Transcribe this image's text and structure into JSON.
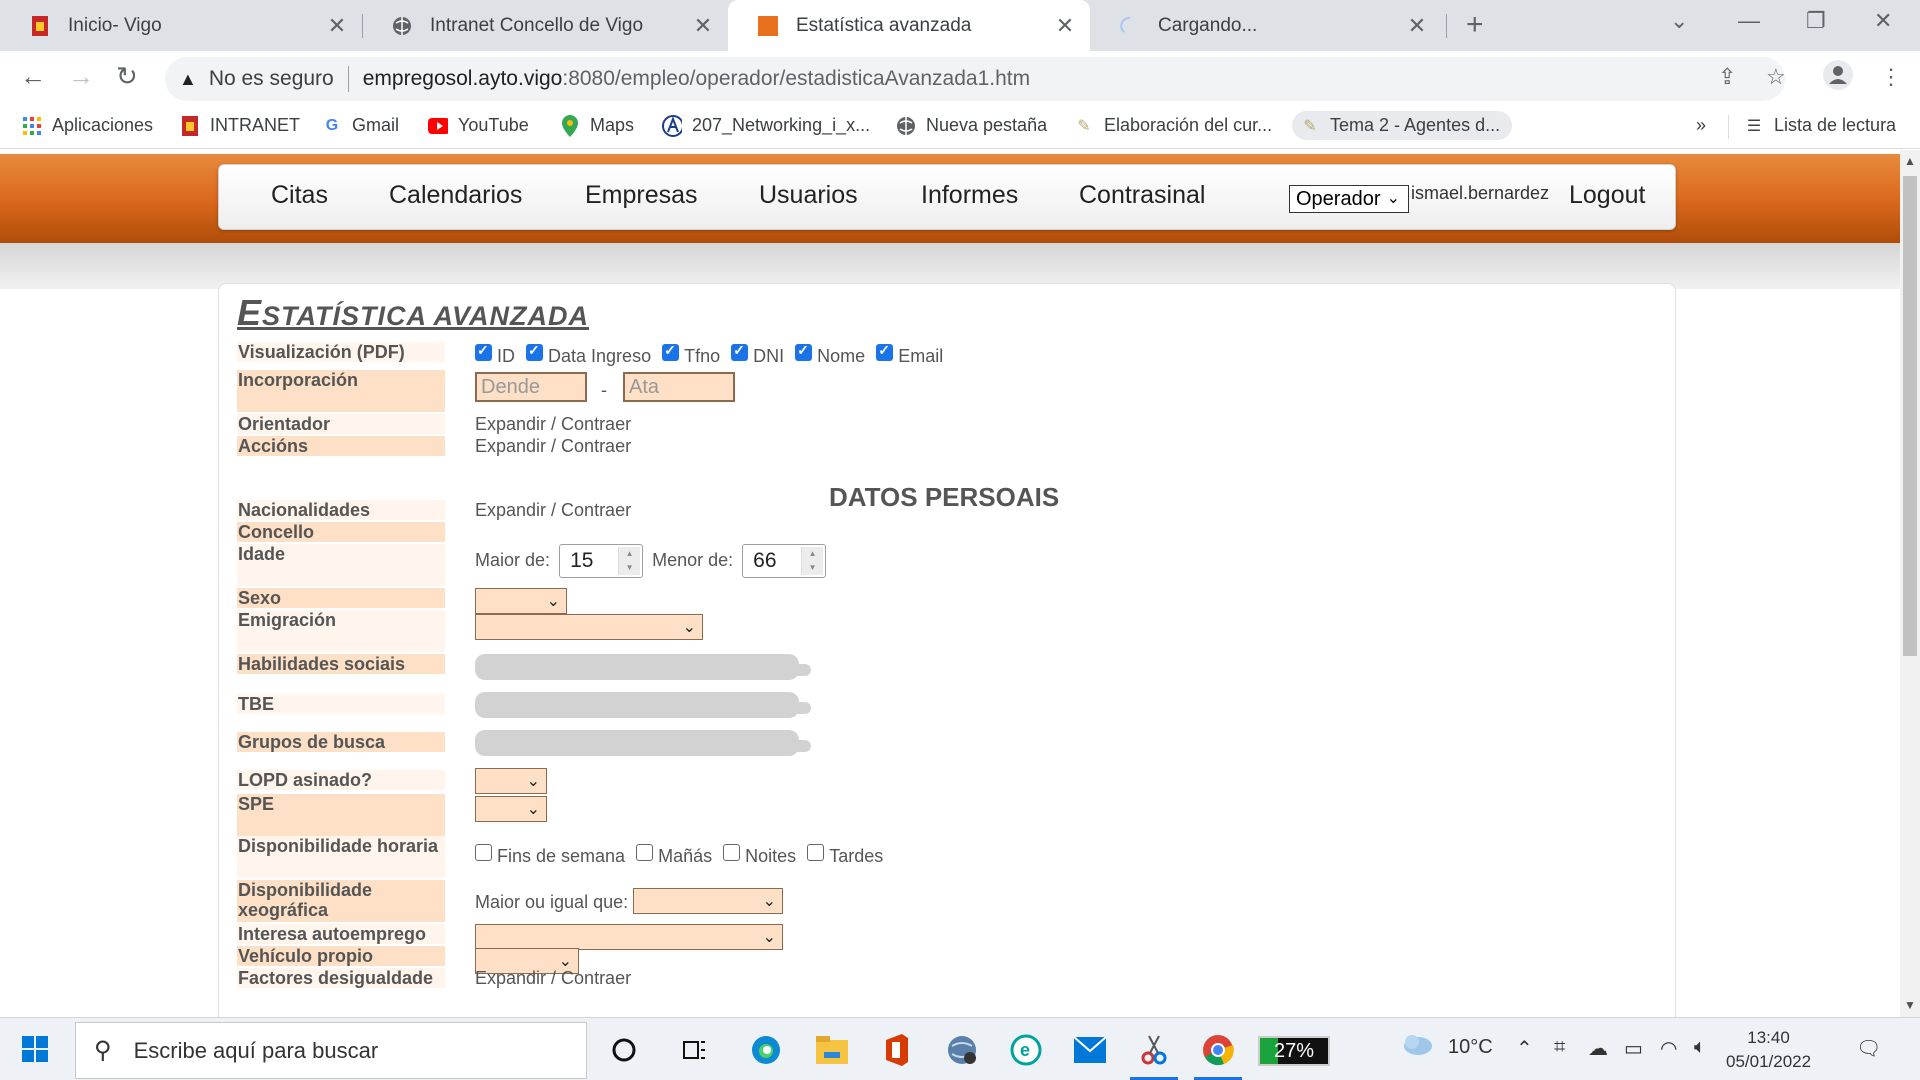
{
  "browser": {
    "tabs": [
      {
        "title": "Inicio- Vigo",
        "icon": "vigo-favicon",
        "active": false
      },
      {
        "title": "Intranet Concello de Vigo",
        "icon": "globe-icon",
        "active": false
      },
      {
        "title": "Estatística avanzada",
        "icon": "orange-square-favicon",
        "active": true
      },
      {
        "title": "Cargando...",
        "icon": "loading-spinner-icon",
        "active": false
      }
    ],
    "security_label": "No es seguro",
    "url_host": "empregosol.ayto.vigo",
    "url_path": ":8080/empleo/operador/estadisticaAvanzada1.htm",
    "bookmarks": [
      {
        "label": "Aplicaciones",
        "icon": "apps-grid-icon"
      },
      {
        "label": "INTRANET",
        "icon": "vigo-favicon"
      },
      {
        "label": "Gmail",
        "icon": "google-icon"
      },
      {
        "label": "YouTube",
        "icon": "youtube-icon"
      },
      {
        "label": "Maps",
        "icon": "maps-pin-icon"
      },
      {
        "label": "207_Networking_i_x...",
        "icon": "a-logo-icon"
      },
      {
        "label": "Nueva pestaña",
        "icon": "globe-icon"
      },
      {
        "label": "Elaboración del cur...",
        "icon": "quill-icon"
      },
      {
        "label": "Tema 2 - Agentes d...",
        "icon": "quill-icon"
      }
    ],
    "bookmarks_overflow": "»",
    "reading_list": "Lista de lectura"
  },
  "nav": {
    "links": [
      "Citas",
      "Calendarios",
      "Empresas",
      "Usuarios",
      "Informes",
      "Contrasinal"
    ],
    "role_select": "Operador",
    "username": "ismael.bernardez",
    "logout": "Logout"
  },
  "page": {
    "title_first": "E",
    "title_rest": "STATÍSTICA AVANZADA",
    "section_heading": "DATOS PERSOAIS",
    "labels": {
      "visualizacion": "Visualización (PDF)",
      "incorporacion": "Incorporación",
      "orientador": "Orientador",
      "accions": "Accións",
      "nacionalidades": "Nacionalidades",
      "concello": "Concello",
      "idade": "Idade",
      "sexo": "Sexo",
      "emigracion": "Emigración",
      "habilidades": "Habilidades sociais",
      "tbe": "TBE",
      "grupos": "Grupos de busca",
      "lopd": "LOPD asinado?",
      "spe": "SPE",
      "disp_horaria": "Disponibilidade horaria",
      "disp_xeografica": "Disponibilidade xeográfica",
      "autoemprego": "Interesa autoemprego",
      "vehiculo": "Vehículo propio",
      "factores": "Factores desigualdade"
    },
    "pdf_columns": [
      {
        "label": "ID",
        "checked": true
      },
      {
        "label": "Data Ingreso",
        "checked": true
      },
      {
        "label": "Tfno",
        "checked": true
      },
      {
        "label": "DNI",
        "checked": true
      },
      {
        "label": "Nome",
        "checked": true
      },
      {
        "label": "Email",
        "checked": true
      }
    ],
    "date_from_placeholder": "Dende",
    "date_separator": "-",
    "date_to_placeholder": "Ata",
    "expand_toggle": "Expandir / Contraer",
    "age_min_label": "Maior de:",
    "age_min_value": "15",
    "age_max_label": "Menor de:",
    "age_max_value": "66",
    "schedule_options": [
      {
        "label": "Fins de semana",
        "checked": false
      },
      {
        "label": "Mañás",
        "checked": false
      },
      {
        "label": "Noites",
        "checked": false
      },
      {
        "label": "Tardes",
        "checked": false
      }
    ],
    "geo_label": "Maior ou igual que:"
  },
  "taskbar": {
    "search_placeholder": "Escribe aquí para buscar",
    "battery_percent": "27%",
    "battery_level": 0.27,
    "temperature": "10°C",
    "time": "13:40",
    "date": "05/01/2022"
  },
  "colors": {
    "label_orange": "#fde0c5",
    "header_orange": "#d8671a",
    "checkbox_blue": "#1a73e8"
  }
}
